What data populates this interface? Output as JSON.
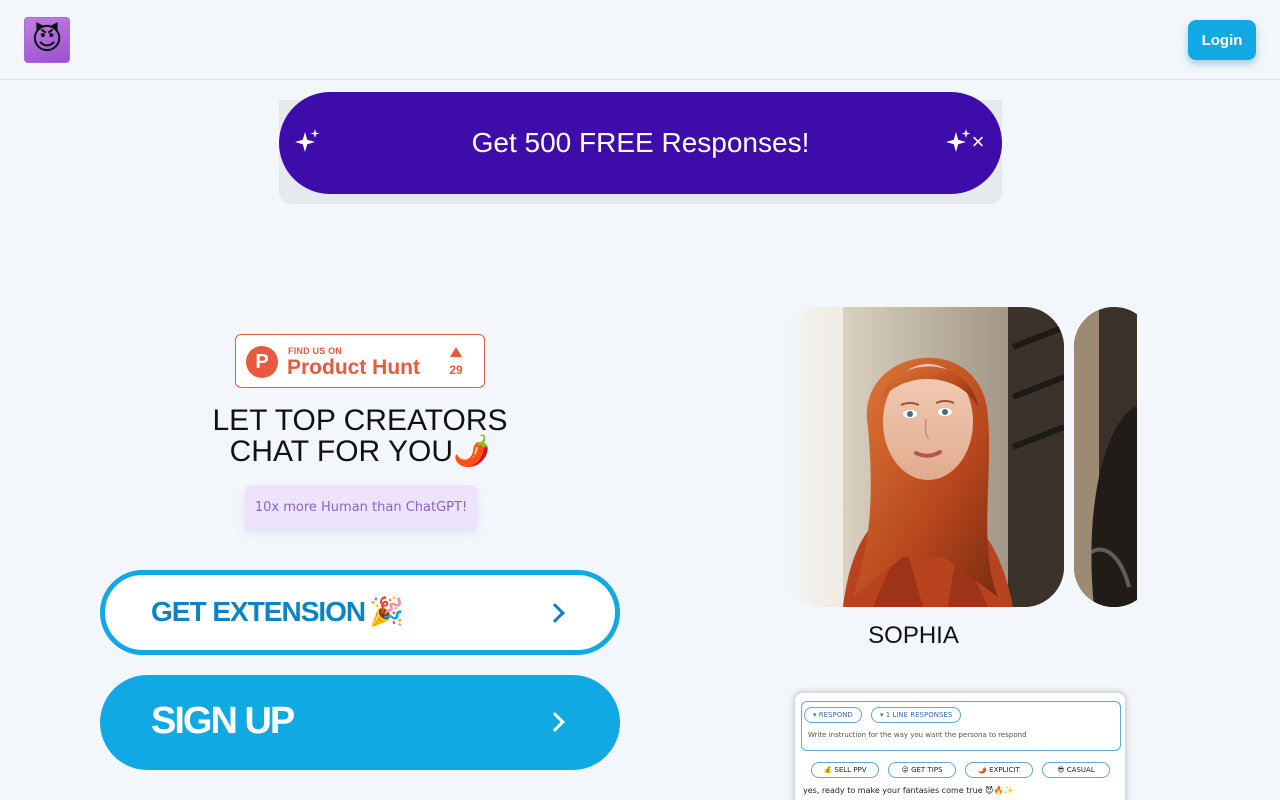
{
  "header": {
    "logo_emoji": "😈",
    "login_label": "Login"
  },
  "promo": {
    "text": "Get 500 FREE Responses!",
    "close_glyph": "×",
    "icon_left": "sparkles-icon",
    "icon_right": "sparkles-icon"
  },
  "product_hunt": {
    "logo_letter": "P",
    "find_text": "FIND US ON",
    "name": "Product Hunt",
    "upvotes": "29"
  },
  "hero": {
    "headline_line1": "LET TOP CREATORS",
    "headline_line2": "CHAT FOR YOU🌶️",
    "tagline": "10x more Human than ChatGPT!"
  },
  "cta": {
    "extension_label": "GET EXTENSION",
    "extension_emoji": "🎉",
    "signup_label": "SIGN UP"
  },
  "persona": {
    "name": "SOPHIA"
  },
  "preview": {
    "chips": [
      "▾ RESPOND",
      "▾ 1 LINE RESPONSES"
    ],
    "instruction": "Write instruction for the way you want the persona to respond",
    "actions": [
      "💰 SELL PPV",
      "😜 GET TIPS",
      "🌶️ EXPLICIT",
      "😎 CASUAL"
    ],
    "message": "yes, ready to make your fantasies come true 😈🔥✨"
  },
  "colors": {
    "background": "#f3f7fb",
    "accent": "#10a9e3",
    "promo": "#3e0ca8",
    "product_hunt": "#e85a3d",
    "tagline_text": "#8a63d2"
  }
}
